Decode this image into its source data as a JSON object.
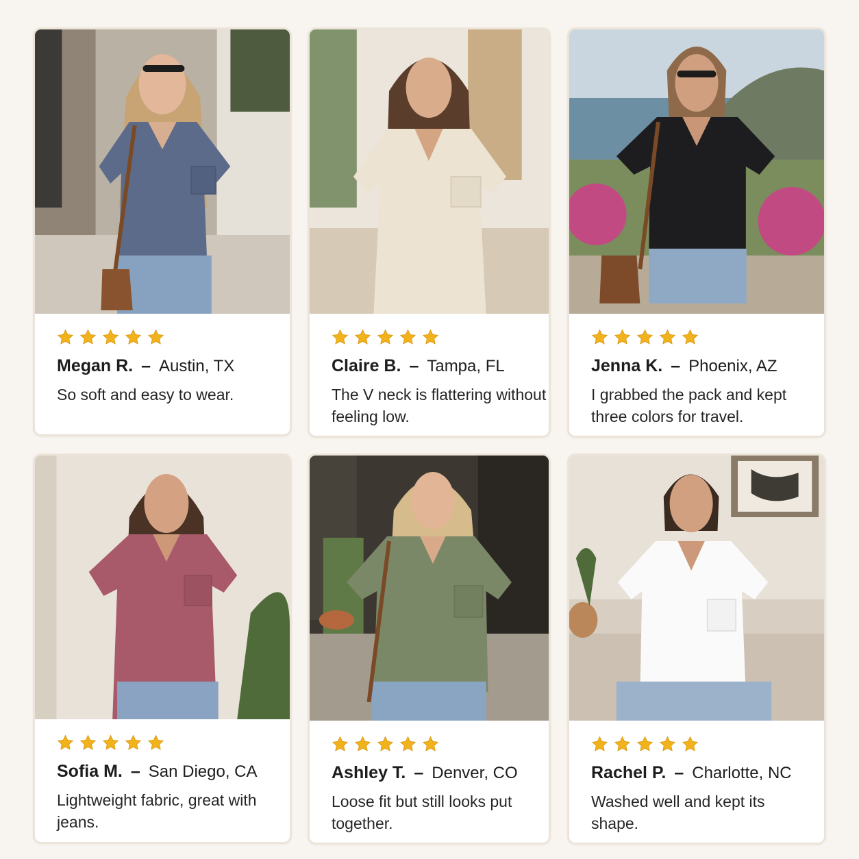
{
  "colors": {
    "background": "#f8f5f0",
    "star": "#f2b21c",
    "card_border": "#ece4d8"
  },
  "icons": {
    "rating": "star-icon"
  },
  "reviews": [
    {
      "rating": 5,
      "name": "Megan R.",
      "separator": "–",
      "location": "Austin, TX",
      "text": "So soft and easy to wear.",
      "shirt_color": "navy blue-gray"
    },
    {
      "rating": 5,
      "name": "Claire B.",
      "separator": "–",
      "location": "Tampa, FL",
      "text": "The V neck is flattering without feeling low.",
      "shirt_color": "oatmeal cream"
    },
    {
      "rating": 5,
      "name": "Jenna K.",
      "separator": "–",
      "location": "Phoenix, AZ",
      "text": "I grabbed the pack and kept three colors for travel.",
      "shirt_color": "black"
    },
    {
      "rating": 5,
      "name": "Sofia M.",
      "separator": "–",
      "location": "San Diego, CA",
      "text": "Lightweight fabric, great with jeans.",
      "shirt_color": "rose"
    },
    {
      "rating": 5,
      "name": "Ashley T.",
      "separator": "–",
      "location": "Denver, CO",
      "text": "Loose fit but still looks put together.",
      "shirt_color": "olive green"
    },
    {
      "rating": 5,
      "name": "Rachel P.",
      "separator": "–",
      "location": "Charlotte, NC",
      "text": "Washed well and kept its shape.",
      "shirt_color": "white"
    }
  ]
}
